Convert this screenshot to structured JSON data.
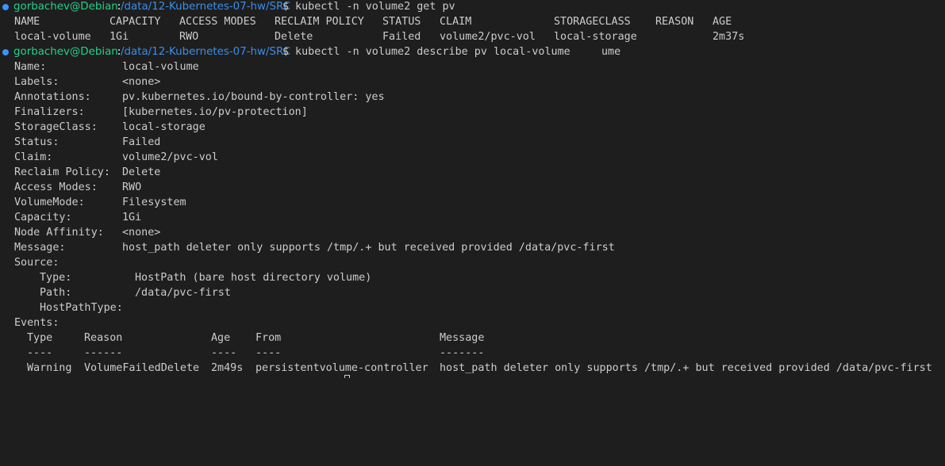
{
  "prompt": {
    "user_host": "gorbachev@Debian",
    "separator": ":",
    "cwd": "/data/12-Kubernetes-07-hw/SRC",
    "symbol": "$"
  },
  "cmd1": " kubectl -n volume2 get pv",
  "pv_table": {
    "headers": [
      "NAME",
      "CAPACITY",
      "ACCESS MODES",
      "RECLAIM POLICY",
      "STATUS",
      "CLAIM",
      "STORAGECLASS",
      "REASON",
      "AGE"
    ],
    "row": [
      "local-volume",
      "1Gi",
      "RWO",
      "Delete",
      "Failed",
      "volume2/pvc-vol",
      "local-storage",
      "",
      "2m37s"
    ]
  },
  "cmd2": " kubectl -n volume2 describe pv local-volume",
  "ghost_text": "ume",
  "describe": [
    {
      "key": "Name:",
      "value": "local-volume"
    },
    {
      "key": "Labels:",
      "value": "<none>"
    },
    {
      "key": "Annotations:",
      "value": "pv.kubernetes.io/bound-by-controller: yes"
    },
    {
      "key": "Finalizers:",
      "value": "[kubernetes.io/pv-protection]"
    },
    {
      "key": "StorageClass:",
      "value": "local-storage"
    },
    {
      "key": "Status:",
      "value": "Failed"
    },
    {
      "key": "Claim:",
      "value": "volume2/pvc-vol"
    },
    {
      "key": "Reclaim Policy:",
      "value": "Delete"
    },
    {
      "key": "Access Modes:",
      "value": "RWO"
    },
    {
      "key": "VolumeMode:",
      "value": "Filesystem"
    },
    {
      "key": "Capacity:",
      "value": "1Gi"
    },
    {
      "key": "Node Affinity:",
      "value": "<none>"
    },
    {
      "key": "Message:",
      "value": "host_path deleter only supports /tmp/.+ but received provided /data/pvc-first"
    },
    {
      "key": "Source:",
      "value": ""
    }
  ],
  "source": [
    {
      "key": "Type:",
      "value": "HostPath (bare host directory volume)"
    },
    {
      "key": "Path:",
      "value": "/data/pvc-first"
    },
    {
      "key": "HostPathType:",
      "value": ""
    }
  ],
  "events": {
    "label": "Events:",
    "headers": [
      "Type",
      "Reason",
      "Age",
      "From",
      "Message"
    ],
    "separators": [
      "----",
      "------",
      "----",
      "----",
      "-------"
    ],
    "row": [
      "Warning",
      "VolumeFailedDelete",
      "2m49s",
      "persistentvolume-controller",
      "host_path deleter only supports /tmp/.+ but received provided /data/pvc-first"
    ]
  },
  "colors": {
    "background": "#1e1e1e",
    "text": "#cccccc",
    "user_host": "#23d18b",
    "path": "#3b8eea",
    "prompt_dot": "#3794ff"
  }
}
